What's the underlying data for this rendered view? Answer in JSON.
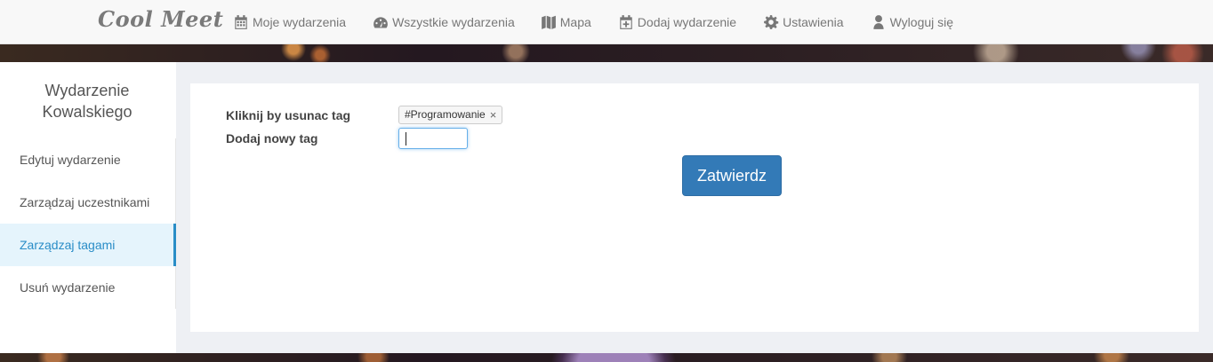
{
  "navbar": {
    "brand": "Cool Meet",
    "items": [
      {
        "label": "Moje wydarzenia",
        "icon": "calendar-icon"
      },
      {
        "label": "Wszystkie wydarzenia",
        "icon": "dashboard-icon"
      },
      {
        "label": "Mapa",
        "icon": "map-icon"
      },
      {
        "label": "Dodaj wydarzenie",
        "icon": "calendar-plus-icon"
      },
      {
        "label": "Ustawienia",
        "icon": "gear-icon"
      },
      {
        "label": "Wyloguj się",
        "icon": "user-icon"
      }
    ]
  },
  "sidebar": {
    "title": "Wydarzenie Kowalskiego",
    "items": [
      {
        "label": "Edytuj wydarzenie"
      },
      {
        "label": "Zarządzaj uczestnikami"
      },
      {
        "label": "Zarządzaj tagami",
        "active": true
      },
      {
        "label": "Usuń wydarzenie"
      }
    ]
  },
  "form": {
    "remove_tag_label": "Kliknij by usunac tag",
    "add_tag_label": "Dodaj nowy tag",
    "tags": [
      "#Programowanie"
    ],
    "new_tag_value": "",
    "submit_label": "Zatwierdz"
  },
  "colors": {
    "primary": "#337ab7",
    "active_sidebar": "#2a8dc7",
    "navbar_bg": "#f8f8f8"
  }
}
